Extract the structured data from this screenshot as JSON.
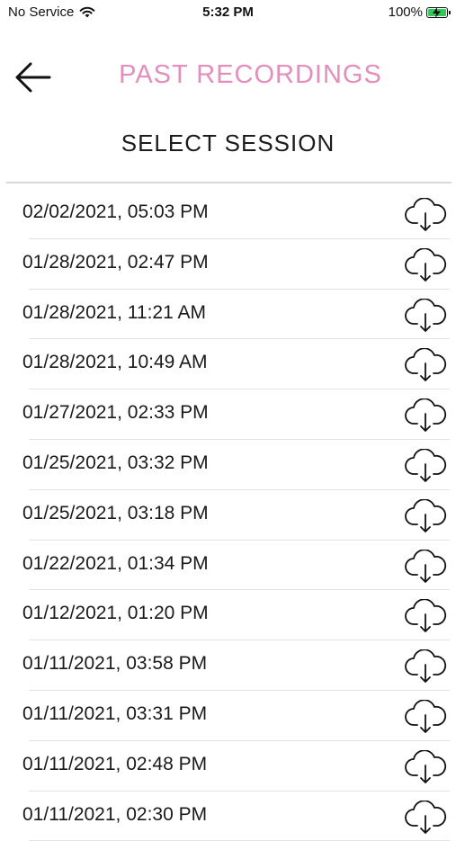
{
  "status_bar": {
    "carrier": "No Service",
    "time": "5:32 PM",
    "battery": "100%"
  },
  "header": {
    "title": "PAST RECORDINGS",
    "subtitle": "SELECT SESSION"
  },
  "colors": {
    "title": "#e48ebd",
    "battery": "#34c759"
  },
  "icons": {
    "back": "arrow-left-icon",
    "download": "cloud-download-icon",
    "wifi": "wifi-icon",
    "battery": "battery-charging-icon"
  },
  "sessions": [
    "02/02/2021, 05:03 PM",
    "01/28/2021, 02:47 PM",
    "01/28/2021, 11:21 AM",
    "01/28/2021, 10:49 AM",
    "01/27/2021, 02:33 PM",
    "01/25/2021, 03:32 PM",
    "01/25/2021, 03:18 PM",
    "01/22/2021, 01:34 PM",
    "01/12/2021, 01:20 PM",
    "01/11/2021, 03:58 PM",
    "01/11/2021, 03:31 PM",
    "01/11/2021, 02:48 PM",
    "01/11/2021, 02:30 PM"
  ]
}
